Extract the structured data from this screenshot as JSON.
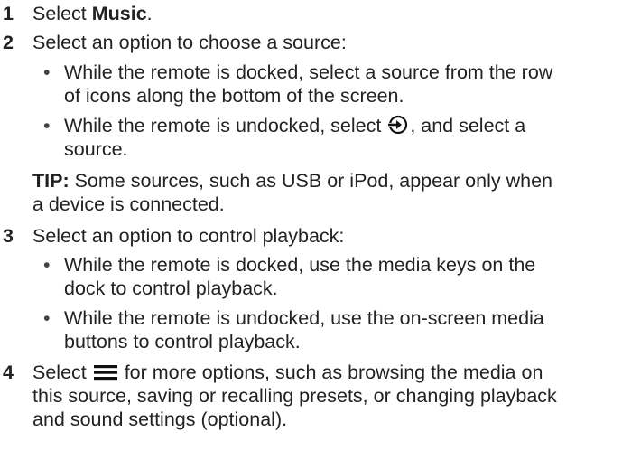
{
  "steps": [
    {
      "number": "1",
      "prefix": "Select ",
      "bold": "Music",
      "suffix": "."
    },
    {
      "number": "2",
      "text": "Select an option to choose a source:",
      "bullets": [
        {
          "lines": [
            "While the remote is docked, select a source from the row",
            "of icons along the bottom of the screen."
          ]
        },
        {
          "line1_before_icon": "While the remote is undocked, select ",
          "icon": "source-arrow-circle-icon",
          "line1_after_icon": ", and select a",
          "line2": "source."
        }
      ],
      "tip_label": "TIP:",
      "tip_line1": " Some sources, such as USB or iPod, appear only when",
      "tip_line2": "a device is connected."
    },
    {
      "number": "3",
      "text": "Select an option to control playback:",
      "bullets": [
        {
          "lines": [
            "While the remote is docked, use the media keys on the",
            "dock to control playback."
          ]
        },
        {
          "lines": [
            "While the remote is undocked, use the on-screen media",
            "buttons to control playback."
          ]
        }
      ]
    },
    {
      "number": "4",
      "before_icon": "Select ",
      "icon": "menu-lines-icon",
      "after_icon": " for more options, such as browsing the media on",
      "lines": [
        "this source, saving or recalling presets, or changing playback",
        "and sound settings (optional)."
      ]
    }
  ],
  "bullet_char": "•",
  "colors": {
    "text": "#222222",
    "icon": "#111111"
  }
}
